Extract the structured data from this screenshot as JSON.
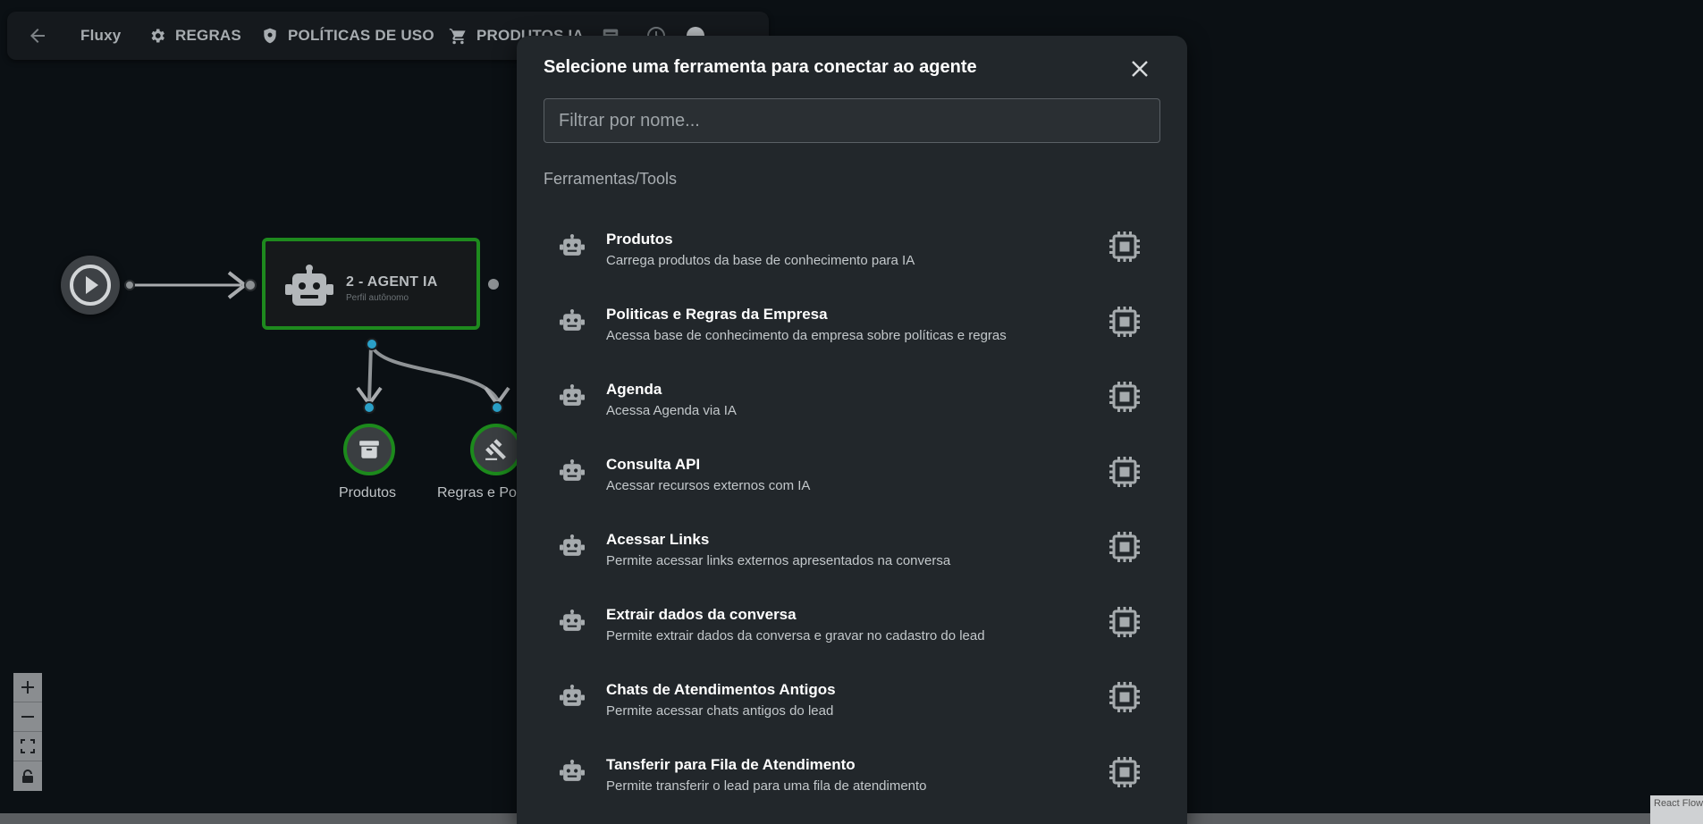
{
  "toolbar": {
    "app_name": "Fluxy",
    "rules_label": "REGRAS",
    "policies_label": "POLÍTICAS DE USO",
    "products_label": "PRODUTOS IA"
  },
  "flow": {
    "agent_node": {
      "title": "2 - AGENT IA",
      "subtitle": "Perfil autônomo"
    },
    "tool_nodes": [
      {
        "label": "Produtos"
      },
      {
        "label": "Regras e Po"
      }
    ]
  },
  "attribution": "React Flow",
  "modal": {
    "title": "Selecione uma ferramenta para conectar ao agente",
    "search_placeholder": "Filtrar por nome...",
    "section_label": "Ferramentas/Tools",
    "tools": [
      {
        "name": "Produtos",
        "description": "Carrega produtos da base de conhecimento para IA"
      },
      {
        "name": "Politicas e Regras da Empresa",
        "description": "Acessa base de conhecimento da empresa sobre políticas e regras"
      },
      {
        "name": "Agenda",
        "description": "Acessa Agenda via IA"
      },
      {
        "name": "Consulta API",
        "description": "Acessar recursos externos com IA"
      },
      {
        "name": "Acessar Links",
        "description": "Permite acessar links externos apresentados na conversa"
      },
      {
        "name": "Extrair dados da conversa",
        "description": "Permite extrair dados da conversa e gravar no cadastro do lead"
      },
      {
        "name": "Chats de Atendimentos Antigos",
        "description": "Permite acessar chats antigos do lead"
      },
      {
        "name": "Tansferir para Fila de Atendimento",
        "description": "Permite transferir o lead para uma fila de atendimento"
      }
    ]
  },
  "colors": {
    "background": "#0b1014",
    "modal_bg": "#22272b",
    "node_border": "#1e8a1e",
    "edge_handle": "#2aa0c8"
  },
  "icons": {
    "back": "arrow-left-icon",
    "rules": "gear-icon",
    "policies": "shield-icon",
    "products": "cart-icon",
    "tool_item": "robot-icon",
    "tool_badge": "chip-icon"
  }
}
